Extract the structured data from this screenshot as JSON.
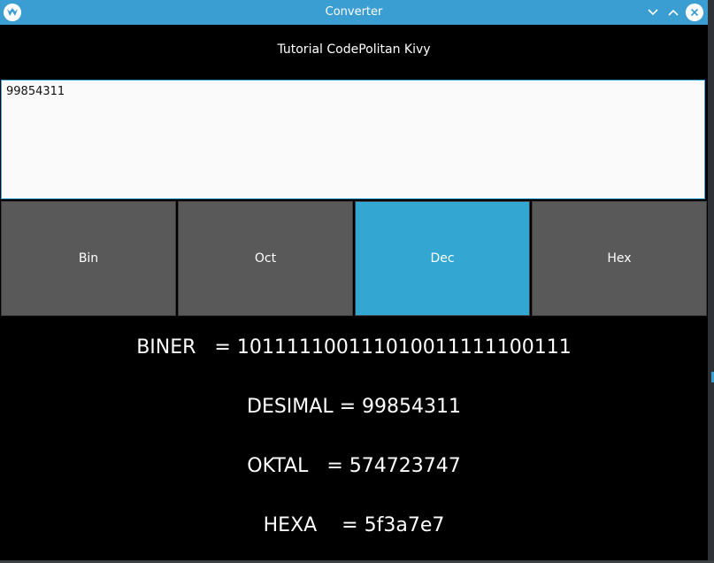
{
  "window": {
    "title": "Converter"
  },
  "app": {
    "subtitle": "Tutorial CodePolitan Kivy",
    "input_value": "99854311"
  },
  "buttons": [
    {
      "label": "Bin",
      "active": false
    },
    {
      "label": "Oct",
      "active": false
    },
    {
      "label": "Dec",
      "active": true
    },
    {
      "label": "Hex",
      "active": false
    }
  ],
  "results": {
    "biner": "BINER   = 101111100111010011111100111",
    "desimal": "DESIMAL = 99854311",
    "oktal": "OKTAL   = 574723747",
    "hexa": "HEXA    = 5f3a7e7"
  },
  "colors": {
    "titlebar": "#3b9ed3",
    "button": "#595959",
    "button_active": "#33a6d1",
    "background": "#000000"
  },
  "icons": {
    "app": "kivy-logo-icon",
    "minimize": "chevron-down-icon",
    "maximize": "chevron-up-icon",
    "close": "close-icon"
  }
}
